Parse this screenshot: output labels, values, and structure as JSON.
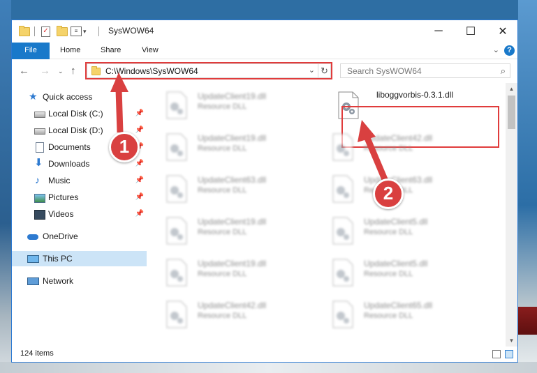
{
  "window": {
    "title": "SysWOW64",
    "minimize": "─",
    "maximize": "☐",
    "close": "✕"
  },
  "ribbon": {
    "tabs": [
      "File",
      "Home",
      "Share",
      "View"
    ],
    "expand": "⌄",
    "help": "?"
  },
  "address": {
    "path": "C:\\Windows\\SysWOW64",
    "dropdown": "⌄",
    "refresh": "↻"
  },
  "search": {
    "placeholder": "Search SysWOW64",
    "icon": "⌕"
  },
  "sidebar": {
    "items": [
      {
        "label": "Quick access",
        "icon": "star-icon",
        "pinned": false
      },
      {
        "label": "Local Disk (C:)",
        "icon": "drive-icon",
        "pinned": true
      },
      {
        "label": "Local Disk (D:)",
        "icon": "drive-icon",
        "pinned": true
      },
      {
        "label": "Documents",
        "icon": "document-icon",
        "pinned": true
      },
      {
        "label": "Downloads",
        "icon": "download-icon",
        "pinned": true
      },
      {
        "label": "Music",
        "icon": "music-icon",
        "pinned": true
      },
      {
        "label": "Pictures",
        "icon": "pictures-icon",
        "pinned": true
      },
      {
        "label": "Videos",
        "icon": "videos-icon",
        "pinned": true
      },
      {
        "label": "OneDrive",
        "icon": "cloud-icon",
        "pinned": false
      },
      {
        "label": "This PC",
        "icon": "pc-icon",
        "pinned": false,
        "selected": true
      },
      {
        "label": "Network",
        "icon": "network-icon",
        "pinned": false
      }
    ]
  },
  "files": {
    "left_column": [
      {
        "name": "UpdateClient19.dll",
        "type": "Resource DLL"
      },
      {
        "name": "UpdateClient19.dll",
        "type": "Resource DLL"
      },
      {
        "name": "UpdateClient63.dll",
        "type": "Resource DLL"
      },
      {
        "name": "UpdateClient19.dll",
        "type": "Resource DLL"
      },
      {
        "name": "UpdateClient19.dll",
        "type": "Resource DLL"
      },
      {
        "name": "UpdateClient42.dll",
        "type": "Resource DLL"
      }
    ],
    "right_column": [
      {
        "name": "liboggvorbis-0.3.1.dll",
        "type": "",
        "highlighted": true
      },
      {
        "name": "UpdateClient42.dll",
        "type": "Resource DLL"
      },
      {
        "name": "UpdateClient63.dll",
        "type": "Resource DLL"
      },
      {
        "name": "UpdateClient5.dll",
        "type": "Resource DLL"
      },
      {
        "name": "UpdateClient5.dll",
        "type": "Resource DLL"
      },
      {
        "name": "UpdateClient65.dll",
        "type": "Resource DLL"
      }
    ]
  },
  "status": {
    "item_count": "124 items"
  },
  "annotations": {
    "marker1": "1",
    "marker2": "2",
    "color": "#d94040"
  }
}
